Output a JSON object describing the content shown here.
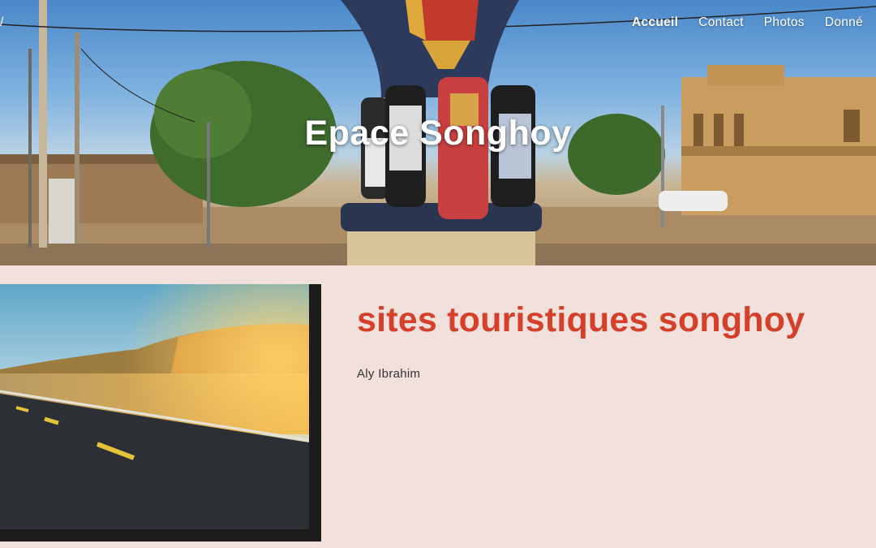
{
  "colors": {
    "accent": "#d4402a",
    "background": "#f2e0dc",
    "nav_text": "#ffffff"
  },
  "nav": {
    "edge_glyph": "/",
    "items": [
      {
        "label": "Accueil",
        "active": true
      },
      {
        "label": "Contact",
        "active": false
      },
      {
        "label": "Photos",
        "active": false
      },
      {
        "label": "Donné",
        "active": false
      }
    ]
  },
  "hero": {
    "title": "Epace Songhoy"
  },
  "post": {
    "title": "sites touristiques songhoy",
    "author": "Aly Ibrahim"
  }
}
